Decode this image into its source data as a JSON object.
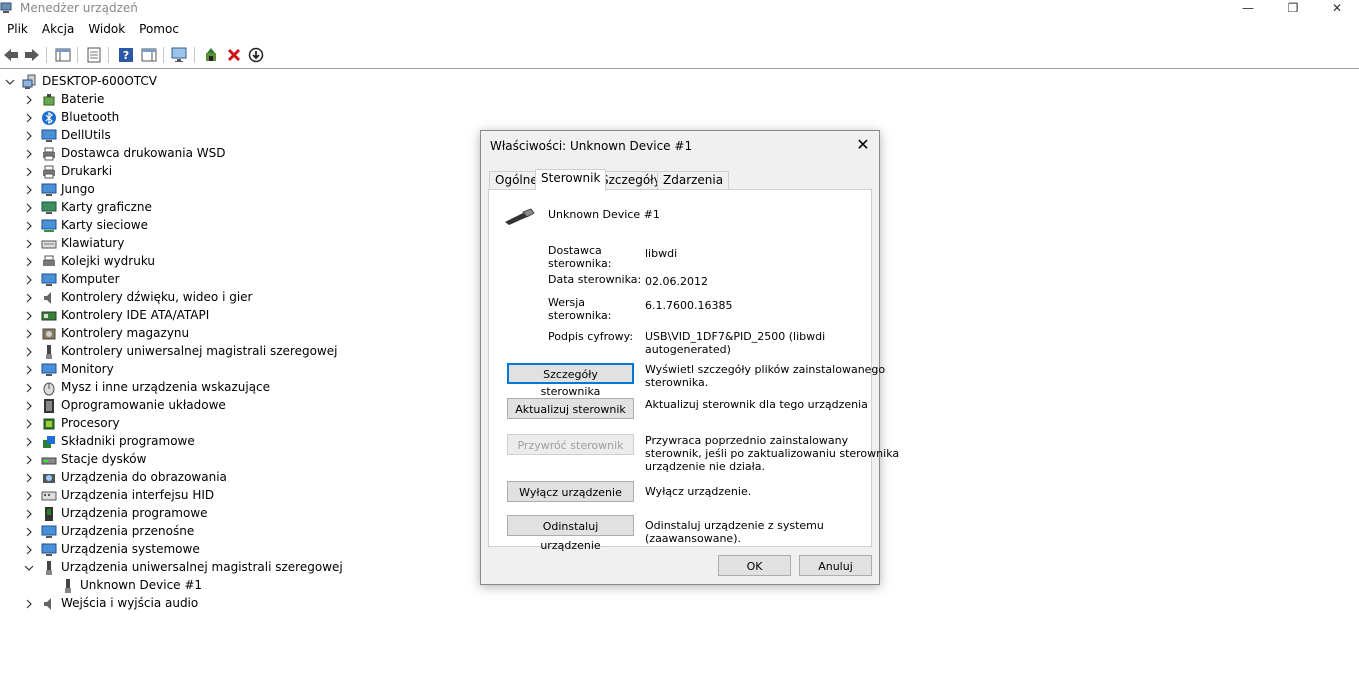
{
  "window": {
    "title": "Menedżer urządzeń",
    "minimize": "—",
    "maximize": "❐",
    "close": "✕"
  },
  "menu": [
    "Plik",
    "Akcja",
    "Widok",
    "Pomoc"
  ],
  "tree": {
    "root": "DESKTOP-600OTCV",
    "categories": [
      "Baterie",
      "Bluetooth",
      "DellUtils",
      "Dostawca drukowania WSD",
      "Drukarki",
      "Jungo",
      "Karty graficzne",
      "Karty sieciowe",
      "Klawiatury",
      "Kolejki wydruku",
      "Komputer",
      "Kontrolery dźwięku, wideo i gier",
      "Kontrolery IDE ATA/ATAPI",
      "Kontrolery magazynu",
      "Kontrolery uniwersalnej magistrali szeregowej",
      "Monitory",
      "Mysz i inne urządzenia wskazujące",
      "Oprogramowanie układowe",
      "Procesory",
      "Składniki programowe",
      "Stacje dysków",
      "Urządzenia do obrazowania",
      "Urządzenia interfejsu HID",
      "Urządzenia programowe",
      "Urządzenia przenośne",
      "Urządzenia systemowe",
      "Urządzenia uniwersalnej magistrali szeregowej"
    ],
    "expanded_child": "Unknown Device #1",
    "last_category": "Wejścia i wyjścia audio"
  },
  "dialog": {
    "title": "Właściwości: Unknown Device #1",
    "close": "✕",
    "tabs": [
      "Ogólne",
      "Sterownik",
      "Szczegóły",
      "Zdarzenia"
    ],
    "device_name": "Unknown Device #1",
    "fields": {
      "provider_label": "Dostawca\nsterownika:",
      "provider_value": "libwdi",
      "date_label": "Data sterownika:",
      "date_value": "02.06.2012",
      "version_label": "Wersja\nsterownika:",
      "version_value": "6.1.7600.16385",
      "signer_label": "Podpis cyfrowy:",
      "signer_value": "USB\\VID_1DF7&PID_2500 (libwdi\nautogenerated)"
    },
    "buttons": [
      {
        "label": "Szczegóły sterownika",
        "desc": "Wyświetl szczegóły plików zainstalowanego\nsterownika."
      },
      {
        "label": "Aktualizuj sterownik",
        "desc": "Aktualizuj sterownik dla tego urządzenia"
      },
      {
        "label": "Przywróć sterownik",
        "desc": "Przywraca poprzednio zainstalowany\nsterownik, jeśli po zaktualizowaniu sterownika\nurządzenie nie działa."
      },
      {
        "label": "Wyłącz urządzenie",
        "desc": "Wyłącz urządzenie."
      },
      {
        "label": "Odinstaluj urządzenie",
        "desc": "Odinstaluj urządzenie z systemu\n(zaawansowane)."
      }
    ],
    "ok": "OK",
    "cancel": "Anuluj"
  }
}
